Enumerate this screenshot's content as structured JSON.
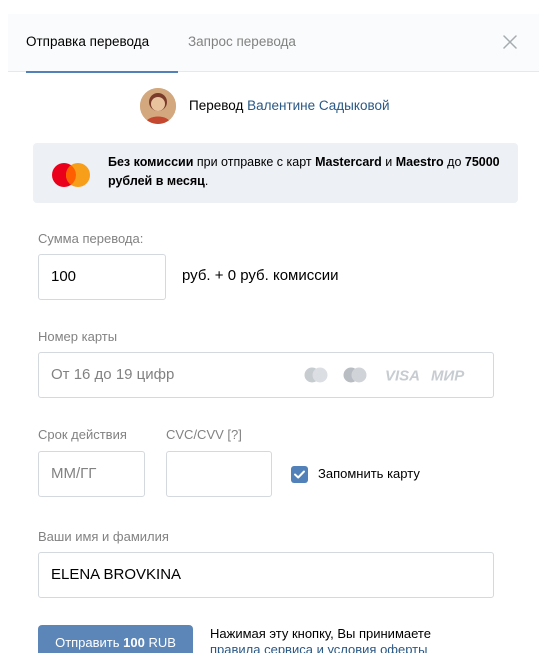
{
  "tabs": {
    "send": "Отправка перевода",
    "request": "Запрос перевода"
  },
  "recipient": {
    "prefix": "Перевод",
    "name": "Валентине Садыковой"
  },
  "promo": {
    "bold1": "Без комиссии",
    "text1": " при отправке с карт ",
    "bold2": "Mastercard",
    "text2": " и ",
    "bold3": "Maestro",
    "text3": " до ",
    "bold4": "75000 рублей в месяц",
    "text4": "."
  },
  "amount": {
    "label": "Сумма перевода:",
    "value": "100",
    "suffix": "руб. + 0 руб. комиссии"
  },
  "card_number": {
    "label": "Номер карты",
    "placeholder": "От 16 до 19 цифр",
    "logos": [
      "VISA",
      "МИР"
    ]
  },
  "expiry": {
    "label": "Срок действия",
    "placeholder": "ММ/ГГ"
  },
  "cvc": {
    "label": "CVC/CVV [?]",
    "value": ""
  },
  "remember": {
    "label": "Запомнить карту",
    "checked": true
  },
  "name": {
    "label": "Ваши имя и фамилия",
    "value": "ELENA BROVKINA"
  },
  "submit": {
    "prefix": "Отправить ",
    "amount": "100",
    "currency": " RUB"
  },
  "terms": {
    "line1": "Нажимая эту кнопку, Вы принимаете",
    "line2": "правила сервиса и условия оферты"
  },
  "colors": {
    "accent": "#5181b8",
    "link": "#2a5885",
    "muted": "#828282",
    "promo_bg": "#edf0f5"
  }
}
